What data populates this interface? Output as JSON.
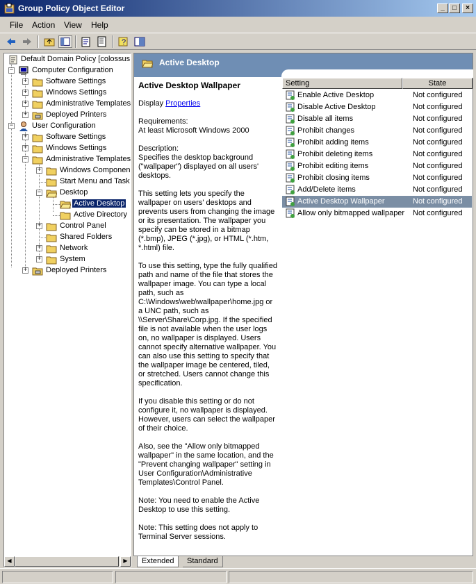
{
  "window": {
    "title": "Group Policy Object Editor",
    "buttons": {
      "minimize": "_",
      "maximize": "□",
      "close": "×"
    }
  },
  "menu": {
    "file": "File",
    "action": "Action",
    "view": "View",
    "help": "Help"
  },
  "toolbar": {
    "items": [
      "back-icon",
      "forward-icon",
      "up-folder-icon",
      "show-hide-tree-icon",
      "properties-icon",
      "export-list-icon",
      "help-icon",
      "console-tree-icon"
    ]
  },
  "tree": {
    "root": "Default Domain Policy [colossus.u",
    "computer_config": "Computer Configuration",
    "cc_software": "Software Settings",
    "cc_windows": "Windows Settings",
    "cc_admin": "Administrative Templates",
    "cc_printers": "Deployed Printers",
    "user_config": "User Configuration",
    "uc_software": "Software Settings",
    "uc_windows": "Windows Settings",
    "uc_admin": "Administrative Templates",
    "windows_components": "Windows Componen",
    "start_menu": "Start Menu and Task",
    "desktop": "Desktop",
    "active_desktop": "Active Desktop",
    "active_directory": "Active Directory",
    "control_panel": "Control Panel",
    "shared_folders": "Shared Folders",
    "network": "Network",
    "system": "System",
    "uc_printers": "Deployed Printers"
  },
  "right_pane": {
    "header": "Active Desktop"
  },
  "description": {
    "title": "Active Desktop Wallpaper",
    "display": "Display ",
    "properties_link": "Properties",
    "req_label": "Requirements:",
    "req_value": "At least Microsoft Windows 2000",
    "desc_label": "Description:",
    "p1": "Specifies the desktop background (\"wallpaper\") displayed on all users' desktops.",
    "p2": "This setting lets you specify the wallpaper on users' desktops and prevents users from changing the image or its presentation. The wallpaper you specify can be stored in a bitmap (*.bmp), JPEG (*.jpg), or HTML (*.htm, *.html) file.",
    "p3": "To use this setting, type the fully qualified path and name of the file that stores the wallpaper image. You can type a local path, such as C:\\Windows\\web\\wallpaper\\home.jpg or a UNC path, such as \\\\Server\\Share\\Corp.jpg. If the specified file is not available when the user logs on, no wallpaper is displayed. Users cannot specify alternative wallpaper. You can also use this setting to specify that the wallpaper image be centered, tiled, or stretched. Users cannot change this specification.",
    "p4": "If you disable this setting or do not configure it, no wallpaper is displayed. However, users can select the wallpaper of their choice.",
    "p5": "Also, see the \"Allow only bitmapped wallpaper\" in the same location, and the \"Prevent changing wallpaper\" setting in User Configuration\\Administrative Templates\\Control Panel.",
    "p6": "Note: You need to enable the Active Desktop to use this setting.",
    "p7": "Note: This setting does not apply to Terminal Server sessions."
  },
  "list": {
    "col_setting": "Setting",
    "col_state": "State",
    "rows": [
      {
        "name": "Enable Active Desktop",
        "state": "Not configured"
      },
      {
        "name": "Disable Active Desktop",
        "state": "Not configured"
      },
      {
        "name": "Disable all items",
        "state": "Not configured"
      },
      {
        "name": "Prohibit changes",
        "state": "Not configured"
      },
      {
        "name": "Prohibit adding items",
        "state": "Not configured"
      },
      {
        "name": "Prohibit deleting items",
        "state": "Not configured"
      },
      {
        "name": "Prohibit editing items",
        "state": "Not configured"
      },
      {
        "name": "Prohibit closing items",
        "state": "Not configured"
      },
      {
        "name": "Add/Delete items",
        "state": "Not configured"
      },
      {
        "name": "Active Desktop Wallpaper",
        "state": "Not configured"
      },
      {
        "name": "Allow only bitmapped wallpaper",
        "state": "Not configured"
      }
    ]
  },
  "tabs": {
    "extended": "Extended",
    "standard": "Standard"
  }
}
